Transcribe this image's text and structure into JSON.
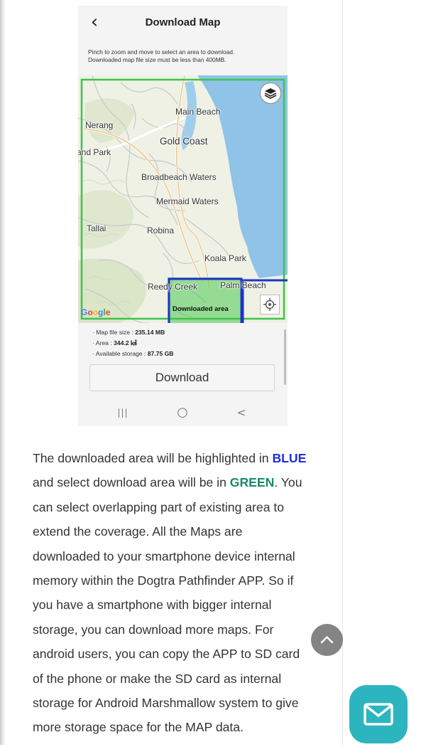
{
  "app": {
    "title": "Download Map",
    "instructions": [
      "Pinch to zoom and move to select an area to download.",
      "Downloaded map file size must be less than 400MB."
    ]
  },
  "map": {
    "labels": {
      "main_beach": "Main Beach",
      "nerang": "Nerang",
      "and_park": "and Park",
      "gold_coast": "Gold Coast",
      "broadbeach_waters": "Broadbeach Waters",
      "mermaid_waters": "Mermaid Waters",
      "tallai": "Tallai",
      "robina": "Robina",
      "koala_park": "Koala Park",
      "reedy_creek": "Reedy Creek",
      "palm_beach": "Palm Beach"
    },
    "downloaded_area_label": "Downloaded area",
    "google_logo": "Google",
    "colors": {
      "selection": "#3ec44a",
      "downloaded": "#1f33c8",
      "water": "#8fc3e8"
    },
    "icons": {
      "layers": "layers-icon",
      "locate": "crosshair-icon"
    }
  },
  "info": {
    "file_size_label": "Map file size : ",
    "file_size_value": "235.14 MB",
    "area_label": "Area : ",
    "area_value": "344.2 ㎢",
    "storage_label": "Available storage : ",
    "storage_value": "87.75 GB"
  },
  "download_button": "Download",
  "navbar": {
    "recent": "|||",
    "home": "○",
    "back": "<"
  },
  "article": {
    "l1_pre": "The downloaded area will be highlighted in ",
    "blue": "BLUE",
    "l2_pre": "and select download area will be in ",
    "green": "GREEN",
    "l2_post": ". You",
    "lines": [
      "can select overlapping part of existing area to",
      "extend the coverage. All the Maps are",
      "downloaded to your smartphone device internal",
      "memory within the Dogtra Pathfinder APP. So if",
      "you have a smartphone with bigger internal",
      "storage, you can download more maps. For",
      "android users, you can copy the APP to SD card",
      "of the phone or make the SD card as internal",
      "storage for Android Marshmallow system to give",
      "more storage space for the MAP data."
    ]
  },
  "floating": {
    "scroll_top": "chevron-up-icon",
    "mail": "mail-icon"
  }
}
